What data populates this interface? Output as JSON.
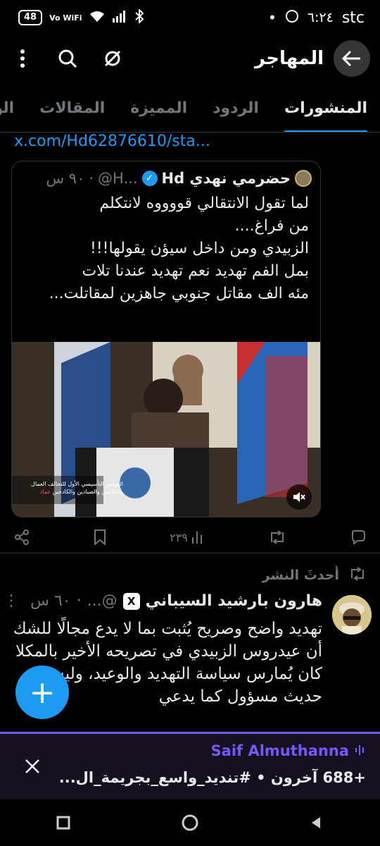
{
  "status": {
    "battery": "48",
    "network": "Vo WiFi",
    "time": "٦:٢٤",
    "carrier": "stc"
  },
  "header": {
    "title": "المهاجر"
  },
  "tabs": [
    {
      "label": "المنشورات",
      "active": true
    },
    {
      "label": "الردود"
    },
    {
      "label": "المميزة"
    },
    {
      "label": "المقالات"
    },
    {
      "label": "الوسائط"
    }
  ],
  "post1": {
    "link": "x.com/Hd62876610/sta...",
    "quote": {
      "name": "حضرمي نهدي Hd",
      "handle": "@H...",
      "time": "٩٠ س",
      "lines": [
        "لما تقول الانتقالي قووووه لانتكلم",
        "من فراغ....",
        "الزبيدي ومن داخل سيؤن يقولها!!!",
        "بمل الفم تهديد نعم تهديد عندنا تلات",
        "مئه الف مقاتل جنوبي جاهزين لمقاتلت..."
      ],
      "media_caption": "المؤتمر التأسيسي الأول للتحالف العمال والفلاحين والصيادين والكادحين",
      "media_caption_accent": "عماد"
    },
    "views": "٢٣٩"
  },
  "recent_label": "أحدثَ النشر",
  "post2": {
    "name": "هارون بارشيد السيباني",
    "handle": "@...",
    "time": "٦٠ س",
    "text": "تهديد واضح وصريح يُثبت بما لا يدع مجالًا للشك أن عيدروس الزبيدي في تصريحه الأخير بالمكلا كان يُمارس سياسة التهديد والوعيد، وليس حديث مسؤول كما يدعي"
  },
  "space": {
    "host": "Saif Almuthanna",
    "subtitle": "+688 آخرون • #تنديد_واسع_بجريمة_ال..."
  },
  "colors": {
    "accent": "#1d9bf0",
    "space": "#7856ff"
  }
}
